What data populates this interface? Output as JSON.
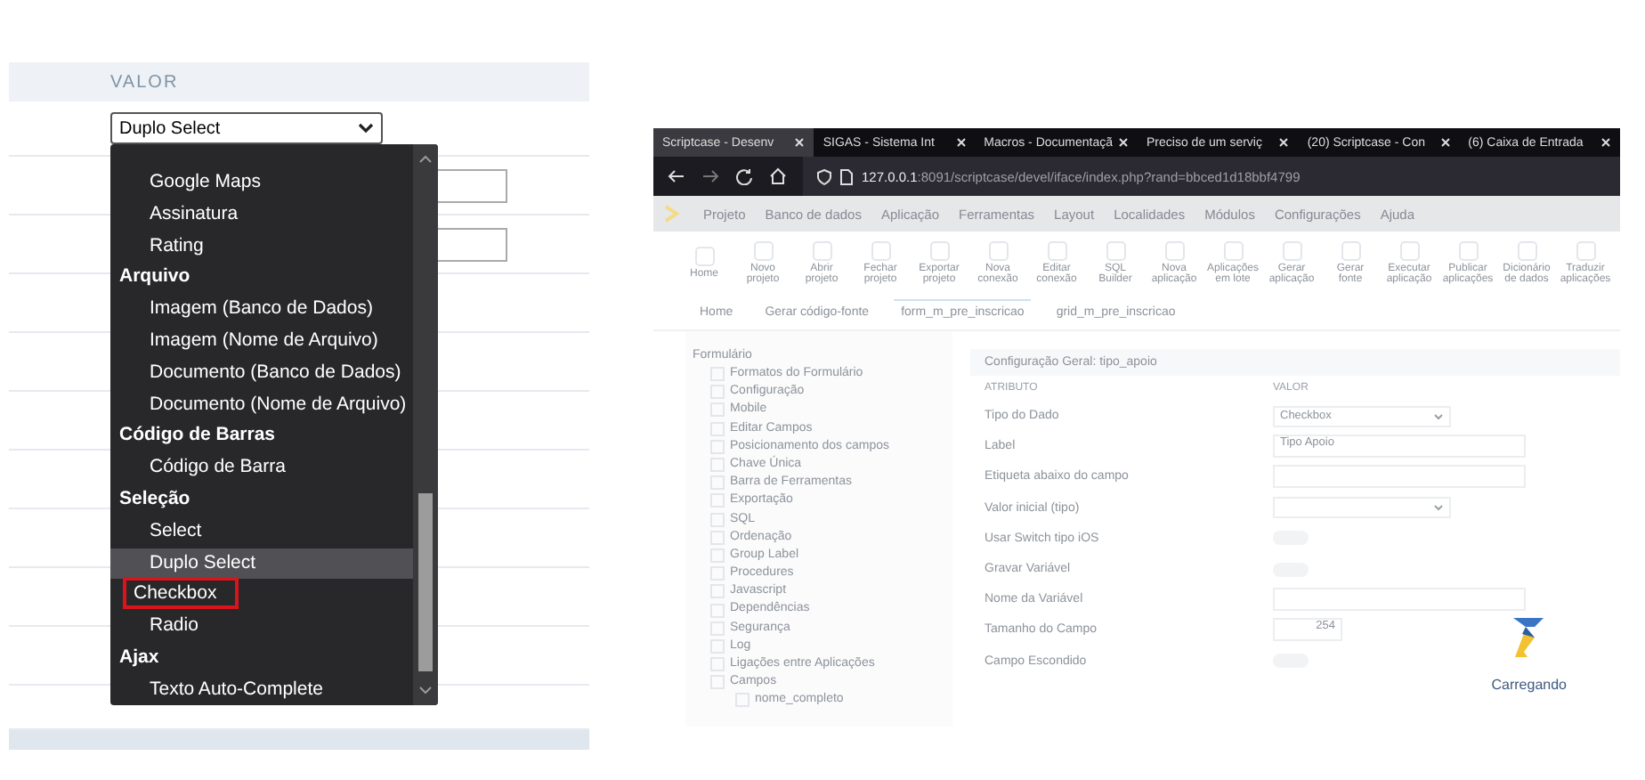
{
  "left_panel": {
    "header": "VALOR",
    "select": {
      "value": "Duplo Select"
    },
    "dropdown": {
      "items": [
        {
          "kind": "option",
          "label": "Google Maps",
          "selected": false,
          "marked": false
        },
        {
          "kind": "option",
          "label": "Assinatura",
          "selected": false,
          "marked": false
        },
        {
          "kind": "option",
          "label": "Rating",
          "selected": false,
          "marked": false
        },
        {
          "kind": "group",
          "label": "Arquivo"
        },
        {
          "kind": "option",
          "label": "Imagem (Banco de Dados)",
          "selected": false,
          "marked": false
        },
        {
          "kind": "option",
          "label": "Imagem (Nome de Arquivo)",
          "selected": false,
          "marked": false
        },
        {
          "kind": "option",
          "label": "Documento (Banco de Dados)",
          "selected": false,
          "marked": false
        },
        {
          "kind": "option",
          "label": "Documento (Nome de Arquivo)",
          "selected": false,
          "marked": false
        },
        {
          "kind": "group",
          "label": "Código de Barras"
        },
        {
          "kind": "option",
          "label": "Código de Barra",
          "selected": false,
          "marked": false
        },
        {
          "kind": "group",
          "label": "Seleção"
        },
        {
          "kind": "option",
          "label": "Select",
          "selected": false,
          "marked": false
        },
        {
          "kind": "option",
          "label": "Duplo Select",
          "selected": true,
          "marked": false
        },
        {
          "kind": "option",
          "label": "Checkbox",
          "selected": false,
          "marked": true
        },
        {
          "kind": "option",
          "label": "Radio",
          "selected": false,
          "marked": false
        },
        {
          "kind": "group",
          "label": "Ajax"
        },
        {
          "kind": "option",
          "label": "Texto Auto-Complete",
          "selected": false,
          "marked": false
        }
      ]
    }
  },
  "browser": {
    "tabs": [
      {
        "title": "Scriptcase - Desenv",
        "selected": true
      },
      {
        "title": "SIGAS - Sistema Int",
        "selected": false
      },
      {
        "title": "Macros - Documentaçã",
        "selected": false
      },
      {
        "title": "Preciso de um serviç",
        "selected": false
      },
      {
        "title": "(20) Scriptcase - Con",
        "selected": false
      },
      {
        "title": "(6) Caixa de Entrada",
        "selected": false
      }
    ],
    "address": {
      "host": "127.0.0.1",
      "path": ":8091/scriptcase/devel/iface/index.php?rand=bbced1d18bbf4799"
    },
    "menu": [
      "Projeto",
      "Banco de dados",
      "Aplicação",
      "Ferramentas",
      "Layout",
      "Localidades",
      "Módulos",
      "Configurações",
      "Ajuda"
    ],
    "toolbar": [
      "Home",
      "Novo projeto",
      "Abrir projeto",
      "Fechar projeto",
      "Exportar projeto",
      "Nova conexão",
      "Editar conexão",
      "SQL Builder",
      "Nova aplicação",
      "Aplicações em lote",
      "Gerar aplicação",
      "Gerar fonte",
      "Executar aplicação",
      "Publicar aplicações",
      "Dicionário de dados",
      "Traduzir aplicações"
    ],
    "doc_tabs": [
      {
        "label": "Home",
        "selected": false
      },
      {
        "label": "Gerar código-fonte",
        "selected": false
      },
      {
        "label": "form_m_pre_inscricao",
        "selected": true
      },
      {
        "label": "grid_m_pre_inscricao",
        "selected": false
      }
    ],
    "tree": {
      "title": "Formulário",
      "items": [
        {
          "label": "Formatos do Formulário"
        },
        {
          "label": "Configuração"
        },
        {
          "label": "Mobile"
        },
        {
          "label": "Editar Campos"
        },
        {
          "label": "Posicionamento dos campos"
        },
        {
          "label": "Chave Única"
        },
        {
          "label": "Barra de Ferramentas"
        },
        {
          "label": "Exportação"
        },
        {
          "label": "SQL"
        },
        {
          "label": "Ordenação"
        },
        {
          "label": "Group Label"
        },
        {
          "label": "Procedures"
        },
        {
          "label": "Javascript"
        },
        {
          "label": "Dependências"
        },
        {
          "label": "Segurança"
        },
        {
          "label": "Log"
        },
        {
          "label": "Ligações entre Aplicações"
        },
        {
          "label": "Campos",
          "children": [
            {
              "label": "nome_completo"
            }
          ]
        }
      ]
    },
    "form": {
      "title": "Configuração Geral: tipo_apoio",
      "columns": [
        "ATRIBUTO",
        "VALOR"
      ],
      "rows": [
        {
          "label": "Tipo do Dado",
          "kind": "select",
          "value": "Checkbox"
        },
        {
          "label": "Label",
          "kind": "text",
          "value": "Tipo Apoio"
        },
        {
          "label": "Etiqueta abaixo do campo",
          "kind": "text"
        },
        {
          "label": "Valor inicial (tipo)",
          "kind": "select"
        },
        {
          "label": "Usar Switch tipo iOS",
          "kind": "toggle",
          "on": false
        },
        {
          "label": "Gravar Variável",
          "kind": "toggle",
          "on": false
        },
        {
          "label": "Nome da Variável",
          "kind": "text"
        },
        {
          "label": "Tamanho do Campo",
          "kind": "number",
          "value": "254"
        },
        {
          "label": "Campo Escondido",
          "kind": "toggle",
          "on": false
        }
      ]
    },
    "loader": {
      "label": "Carregando"
    }
  }
}
